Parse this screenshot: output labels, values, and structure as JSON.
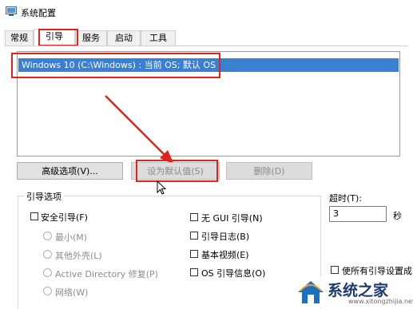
{
  "window": {
    "title": "系统配置",
    "icon": "system-config-icon"
  },
  "tabs": [
    {
      "label": "常规",
      "active": false
    },
    {
      "label": "引导",
      "active": true
    },
    {
      "label": "服务",
      "active": false
    },
    {
      "label": "启动",
      "active": false
    },
    {
      "label": "工具",
      "active": false
    }
  ],
  "boot_list": [
    {
      "label": "Windows 10 (C:\\Windows) : 当前 OS; 默认 OS",
      "selected": true
    }
  ],
  "buttons": {
    "advanced": "高级选项(V)...",
    "set_default": "设为默认值(S)",
    "delete": "删除(D)"
  },
  "boot_options": {
    "legend": "引导选项",
    "safe_boot": {
      "label": "安全引导(F)",
      "checked": false
    },
    "radios": [
      {
        "label": "最小(M)",
        "enabled": false
      },
      {
        "label": "其他外壳(L)",
        "enabled": false
      },
      {
        "label": "Active Directory 修复(P)",
        "enabled": false
      },
      {
        "label": "网络(W)",
        "enabled": false
      }
    ],
    "checks_right": [
      {
        "label": "无 GUI 引导(N)",
        "checked": false
      },
      {
        "label": "引导日志(B)",
        "checked": false
      },
      {
        "label": "基本视频(E)",
        "checked": false
      },
      {
        "label": "OS 引导信息(O)",
        "checked": false
      }
    ]
  },
  "timeout": {
    "label": "超时(T):",
    "value": "3",
    "unit": "秒"
  },
  "permanent": {
    "label": "使所有引导设置成",
    "checked": false
  },
  "watermark": {
    "text": "系统之家",
    "url": "www.xitongzhijia.net"
  },
  "colors": {
    "highlight": "#e0241b",
    "selection": "#3b7fd3"
  }
}
